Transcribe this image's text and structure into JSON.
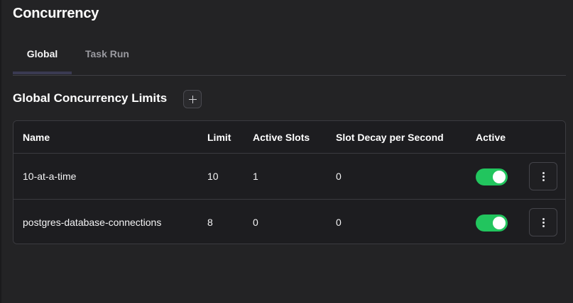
{
  "page": {
    "title": "Concurrency"
  },
  "tabs": [
    {
      "label": "Global",
      "active": true
    },
    {
      "label": "Task Run",
      "active": false
    }
  ],
  "section": {
    "title": "Global Concurrency Limits",
    "add_icon": "plus-icon"
  },
  "table": {
    "columns": [
      "Name",
      "Limit",
      "Active Slots",
      "Slot Decay per Second",
      "Active"
    ],
    "rows": [
      {
        "name": "10-at-a-time",
        "limit": "10",
        "active_slots": "1",
        "slot_decay": "0",
        "active": true
      },
      {
        "name": "postgres-database-connections",
        "limit": "8",
        "active_slots": "0",
        "slot_decay": "0",
        "active": true
      }
    ]
  },
  "colors": {
    "toggle_on": "#22c55e",
    "background": "#232325"
  },
  "icons": {
    "row_menu": "vertical-dots-icon"
  }
}
